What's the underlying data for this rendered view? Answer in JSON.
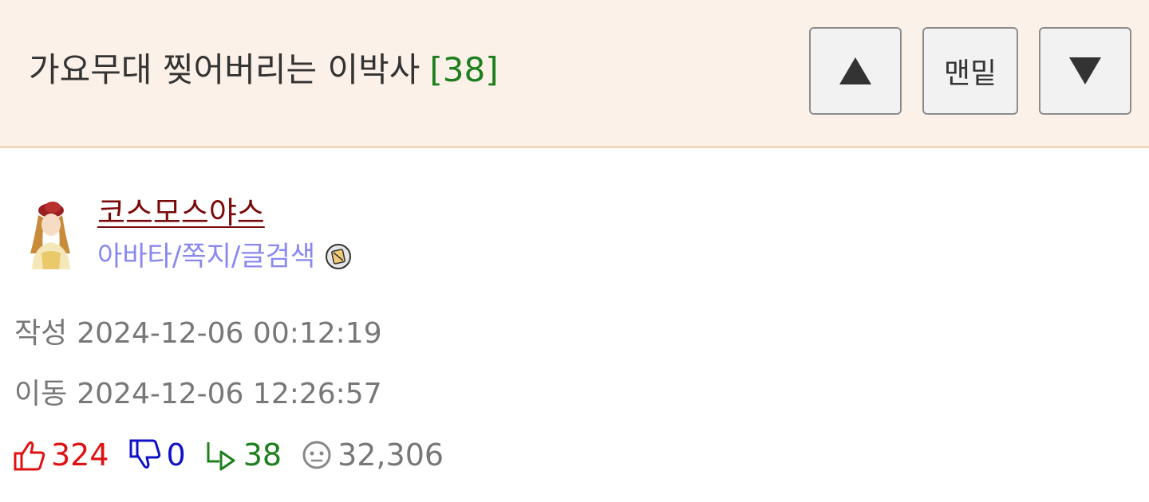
{
  "header": {
    "title": "가요무대 찢어버리는 이박사",
    "comment_count": "[38]",
    "nav": {
      "up_icon": "triangle-up",
      "bottom_label": "맨밑",
      "down_icon": "triangle-down"
    }
  },
  "author": {
    "name": "코스모스야스",
    "links": "아바타/쪽지/글검색",
    "icon": "message-badge-icon"
  },
  "meta": {
    "written_label": "작성",
    "written_time": "2024-12-06 00:12:19",
    "moved_label": "이동",
    "moved_time": "2024-12-06 12:26:57"
  },
  "stats": {
    "upvotes": "324",
    "downvotes": "0",
    "replies": "38",
    "views": "32,306"
  },
  "colors": {
    "header_bg": "#fcf1e8",
    "accent_green": "#1d7f1d",
    "author_red": "#7a0a0a",
    "link_blue": "#8888f0",
    "upvote_red": "#e01010",
    "downvote_blue": "#1010c8"
  }
}
